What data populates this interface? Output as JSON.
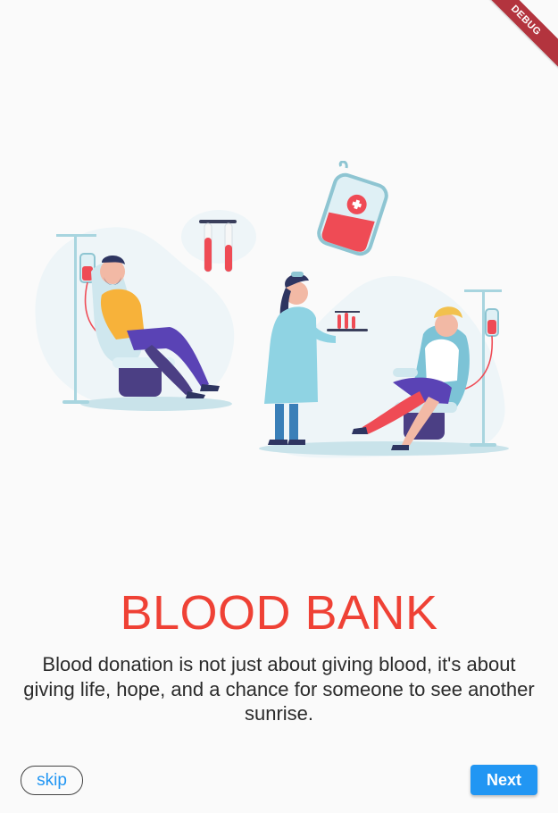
{
  "debug_banner": {
    "label": "DEBUG"
  },
  "onboarding": {
    "title": "BLOOD BANK",
    "description": "Blood donation is not just about giving blood, it's about giving life, hope, and a chance for someone to see another sunrise.",
    "illustration_icon": "blood-donation-illustration"
  },
  "actions": {
    "skip_label": "skip",
    "next_label": "Next"
  },
  "colors": {
    "title": "#ef4135",
    "accent": "#2196f3",
    "background": "#fafafa",
    "debug_ribbon": "#b3343e"
  }
}
